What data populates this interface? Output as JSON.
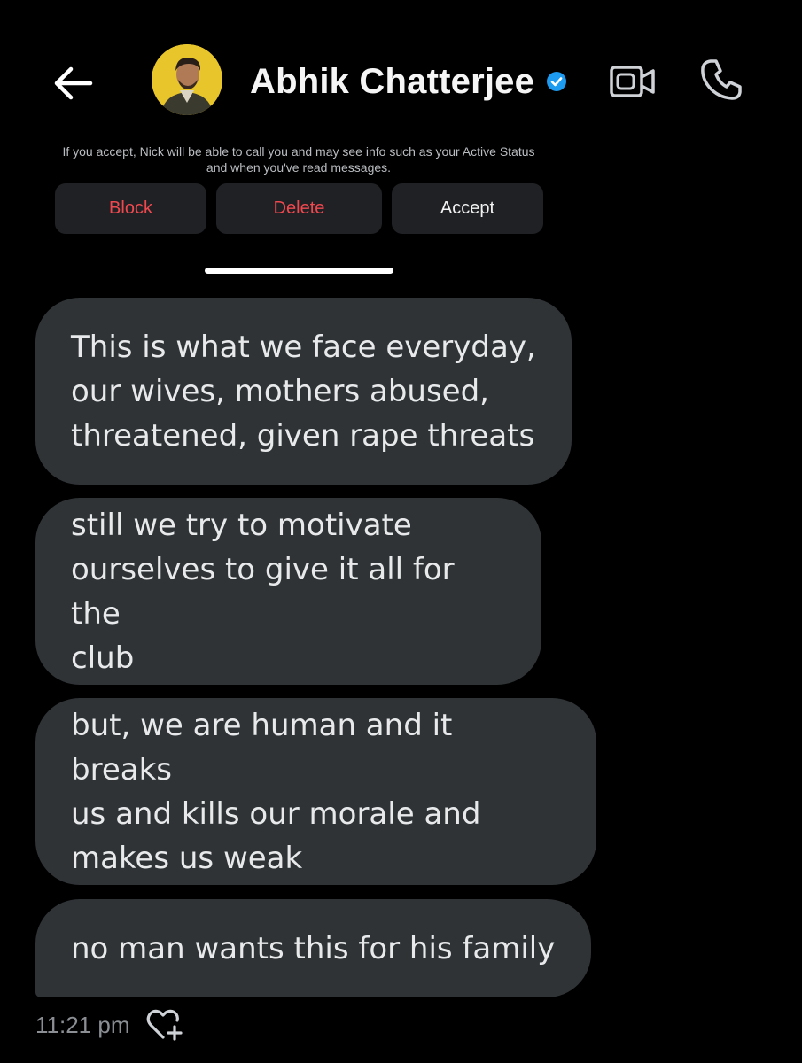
{
  "header": {
    "name": "Abhik Chatterjee",
    "verified": true,
    "icons": {
      "back": "arrow-left-icon",
      "avatar": "profile-photo",
      "verified": "verified-badge-icon",
      "video": "video-camera-icon",
      "call": "phone-icon"
    },
    "verified_color": "#1d9bf0"
  },
  "request": {
    "notice": "If you accept, Nick will be able to call you and may see info such as your Active Status and when you've read messages.",
    "block_label": "Block",
    "delete_label": "Delete",
    "accept_label": "Accept",
    "danger_color": "#f0484f"
  },
  "messages": [
    {
      "text": "This is what we face everyday,\nour wives, mothers abused,\nthreatened, given rape threats"
    },
    {
      "text": "still we try to motivate\nourselves to give it all for the\nclub"
    },
    {
      "text": "but, we are human and it breaks\nus and kills our morale and\nmakes us weak"
    },
    {
      "text": "no man wants this for his family"
    }
  ],
  "footer": {
    "time": "11:21 pm",
    "react_icon": "heart-plus-icon"
  },
  "colors": {
    "background": "#000000",
    "bubble": "#2f3336",
    "text": "#e7e9ea",
    "muted": "#8b8f94"
  }
}
